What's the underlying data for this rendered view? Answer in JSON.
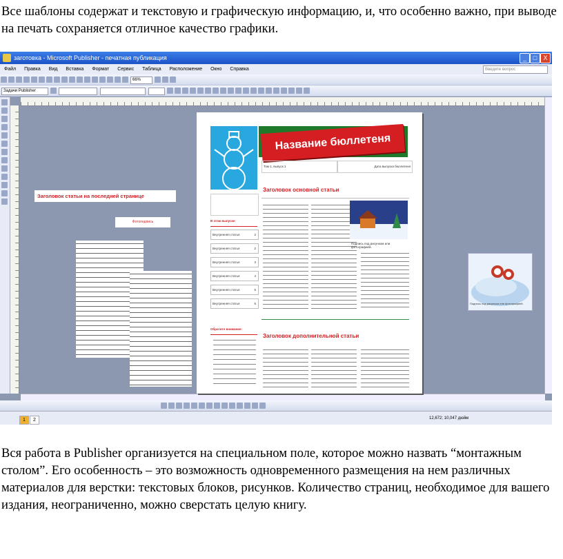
{
  "intro_text": "Все шаблоны содержат и текстовую и графическую информацию, и, что особенно важно, при выводе на печать сохраняется отличное качество графики.",
  "body_text": "Вся работа в Publisher организуется на специальном поле, которое можно назвать “монтажным столом”. Его особенность – это возможность одновременного размещения на нем различных материалов для верстки: текстовых блоков, рисунков. Количество страниц, необходимое для вашего издания, неограниченно, можно сверстать целую книгу.",
  "window": {
    "title": "заготовка - Microsoft Publisher - печатная публикация",
    "buttons": {
      "minimize": "_",
      "maximize": "□",
      "close": "X"
    }
  },
  "menu": [
    "Файл",
    "Правка",
    "Вид",
    "Вставка",
    "Формат",
    "Сервис",
    "Таблица",
    "Расположение",
    "Окно",
    "Справка"
  ],
  "help_placeholder": "Введите вопрос",
  "toolbar": {
    "zoom": "66%",
    "task_pane": "Задачи Publisher"
  },
  "scratch": {
    "last_page_heading": "Заголовок статьи на последней странице",
    "small_caption": "Фотоподпись",
    "snow_caption": "Подпись под рисунком или фотографией."
  },
  "newsletter": {
    "title": "Название бюллетеня",
    "volume": "Том 1, выпуск 1",
    "date": "Дата выпуска бюллетеня",
    "main_heading": "Заголовок основной статьи",
    "secondary_heading": "Заголовок дополнительной статьи",
    "contents_title": "В этом выпуске:",
    "contents_items": [
      {
        "label": "Внутренняя статья",
        "page": "2"
      },
      {
        "label": "Внутренняя статья",
        "page": "2"
      },
      {
        "label": "Внутренняя статья",
        "page": "3"
      },
      {
        "label": "Внутренняя статья",
        "page": "4"
      },
      {
        "label": "Внутренняя статья",
        "page": "5"
      },
      {
        "label": "Внутренняя статья",
        "page": "6"
      }
    ],
    "special_title": "Обратите внимание:",
    "house_caption": "Подпись под рисунком или фотографией."
  },
  "status": {
    "pages": [
      "1",
      "2"
    ],
    "coords": "12,672; 10,047 дюйм"
  }
}
